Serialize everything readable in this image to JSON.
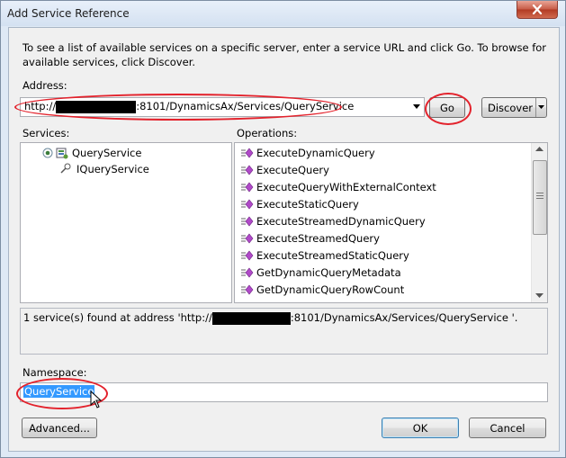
{
  "window": {
    "title": "Add Service Reference"
  },
  "intro_text": "To see a list of available services on a specific server, enter a service URL and click Go. To browse for available services, click Discover.",
  "address": {
    "label": "Address:",
    "value_prefix": "http://",
    "value_suffix": ":8101/DynamicsAx/Services/QueryService",
    "go_label": "Go",
    "discover_label": "Discover"
  },
  "services": {
    "label": "Services:",
    "items": [
      {
        "label": "QueryService"
      },
      {
        "label": "IQueryService"
      }
    ]
  },
  "operations": {
    "label": "Operations:",
    "items": [
      "ExecuteDynamicQuery",
      "ExecuteQuery",
      "ExecuteQueryWithExternalContext",
      "ExecuteStaticQuery",
      "ExecuteStreamedDynamicQuery",
      "ExecuteStreamedQuery",
      "ExecuteStreamedStaticQuery",
      "GetDynamicQueryMetadata",
      "GetDynamicQueryRowCount"
    ]
  },
  "status": {
    "prefix": "1 service(s) found at address 'http://",
    "suffix": ":8101/DynamicsAx/Services/QueryService '."
  },
  "namespace": {
    "label": "Namespace:",
    "value": "QueryService"
  },
  "buttons": {
    "advanced": "Advanced...",
    "ok": "OK",
    "cancel": "Cancel"
  },
  "colors": {
    "highlight_ring": "#e3222c",
    "selection": "#3399ff"
  },
  "icons": [
    "close-icon",
    "dropdown-arrow-icon",
    "service-icon",
    "interface-icon",
    "operation-icon",
    "scroll-up-icon",
    "scroll-down-icon",
    "mouse-cursor-icon"
  ]
}
